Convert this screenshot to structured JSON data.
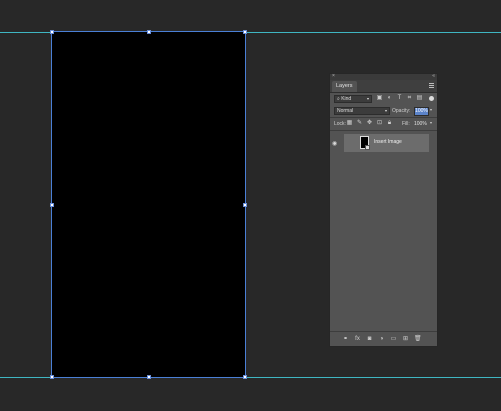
{
  "panel": {
    "close_glyph": "×",
    "collapse_glyph": "«",
    "tab_label": "Layers",
    "menu_icon": "menu-icon",
    "kind_label": "Kind",
    "filter_icons": [
      "image-icon",
      "adjustment-icon",
      "type-icon",
      "shape-icon",
      "smart-object-icon"
    ],
    "blend_mode": "Normal",
    "opacity_label": "Opacity:",
    "opacity_value": "100%",
    "lock_label": "Lock:",
    "lock_icons": [
      "lock-transparent-icon",
      "lock-brush-icon",
      "lock-move-icon",
      "lock-artboard-icon",
      "lock-all-icon"
    ],
    "fill_label": "Fill:",
    "fill_value": "100%",
    "layer": {
      "name": "Insert Image",
      "visible": true
    },
    "bottom_icons": [
      "link-icon",
      "fx-icon",
      "mask-icon",
      "adjustment-layer-icon",
      "folder-icon",
      "new-layer-icon",
      "trash-icon"
    ]
  },
  "colors": {
    "workspace": "#282828",
    "guide": "#3fb6c2",
    "selection": "#4a7fd6",
    "panel": "#535353",
    "layer_selected": "#6c6c6c",
    "opacity_highlight": "#5b83c9"
  }
}
